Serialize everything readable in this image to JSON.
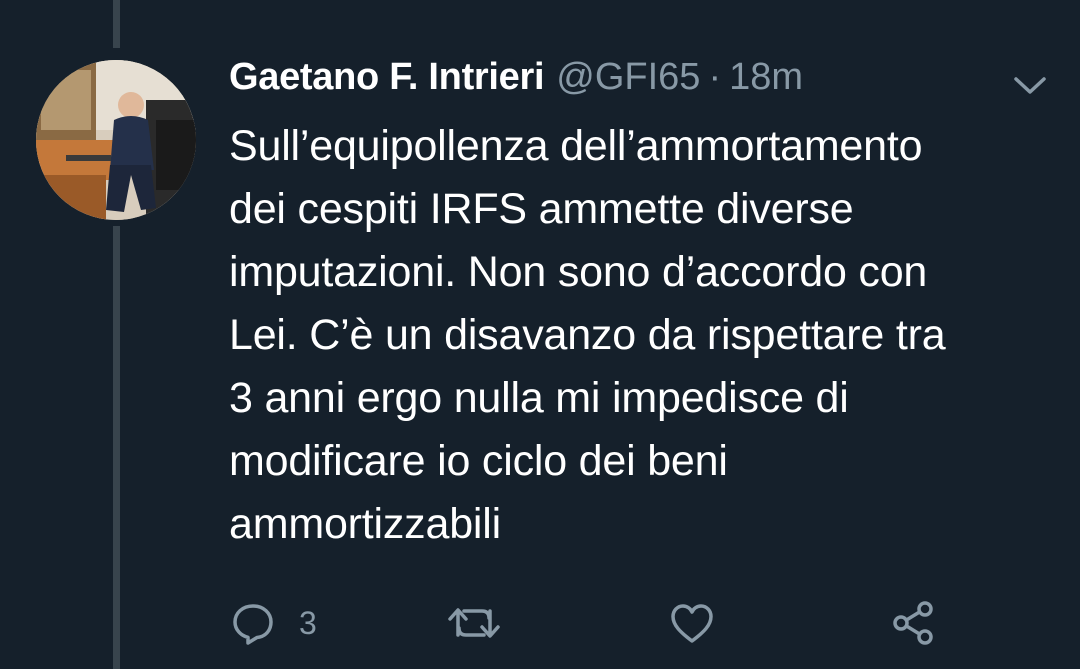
{
  "tweet": {
    "author_name": "Gaetano F. Intrieri",
    "handle": "@GFI65",
    "separator": "·",
    "time": "18m",
    "text_lines": [
      "Sull’equipollenza dell’ammortamento",
      "dei cespiti IRFS ammette diverse",
      "imputazioni. Non sono d’accordo con",
      "Lei. C’è un disavanzo da rispettare tra",
      "3 anni ergo nulla mi impedisce di",
      "modificare io ciclo dei beni",
      "ammortizzabili"
    ]
  },
  "actions": {
    "reply_icon": "reply-icon",
    "reply_count": "3",
    "retweet_icon": "retweet-icon",
    "like_icon": "heart-icon",
    "share_icon": "share-icon"
  },
  "colors": {
    "background": "#15202b",
    "text_primary": "#ffffff",
    "text_secondary": "#8899a6",
    "thread_line": "#38444d"
  }
}
